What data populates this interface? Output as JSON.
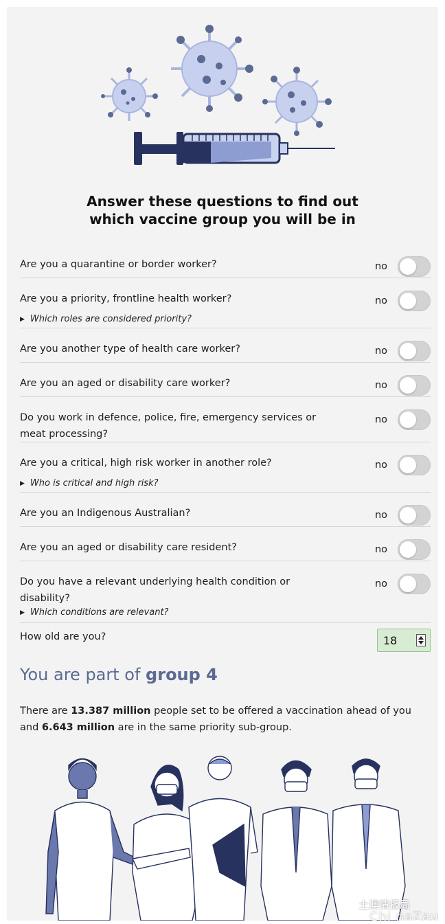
{
  "title": {
    "line1": "Answer these questions to find out",
    "line2": "which vaccine group you will be in"
  },
  "questions": [
    {
      "text": "Are you a quarantine or border worker?",
      "answer": "no",
      "disclosure": ""
    },
    {
      "text": "Are you a priority, frontline health worker?",
      "answer": "no",
      "disclosure": "Which roles are considered priority?"
    },
    {
      "text": "Are you another type of health care worker?",
      "answer": "no",
      "disclosure": ""
    },
    {
      "text": "Are you an aged or disability care worker?",
      "answer": "no",
      "disclosure": ""
    },
    {
      "text": "Do you work in defence, police, fire, emergency services or meat processing?",
      "answer": "no",
      "disclosure": ""
    },
    {
      "text": "Are you a critical, high risk worker in another role?",
      "answer": "no",
      "disclosure": "Who is critical and high risk?"
    },
    {
      "text": "Are you an Indigenous Australian?",
      "answer": "no",
      "disclosure": ""
    },
    {
      "text": "Are you an aged or disability care resident?",
      "answer": "no",
      "disclosure": ""
    },
    {
      "text": "Do you have a relevant underlying health condition or disability?",
      "answer": "no",
      "disclosure": "Which conditions are relevant?"
    }
  ],
  "age": {
    "label": "How old are you?",
    "value": "18"
  },
  "result": {
    "prefix": "You are part of ",
    "group": "group 4"
  },
  "summary": {
    "p1": "There are ",
    "ahead": "13.387 million",
    "p2": " people set to be offered a vaccination ahead of you and ",
    "same": "6.643 million",
    "p3": " are in the same priority sub-group."
  },
  "watermark": {
    "line1": "土澳情报局",
    "line2": "Chi  naZau"
  },
  "colors": {
    "accent": "#5b6a93",
    "illustration": "#27325f",
    "virus": "#b9c4e8",
    "input_bg": "#d7ecd3"
  },
  "icons": [
    "vaccine-syringe-illustration",
    "virus-icon",
    "people-illustration",
    "toggle-switch",
    "disclosure-triangle-icon",
    "number-spinner-icon"
  ]
}
